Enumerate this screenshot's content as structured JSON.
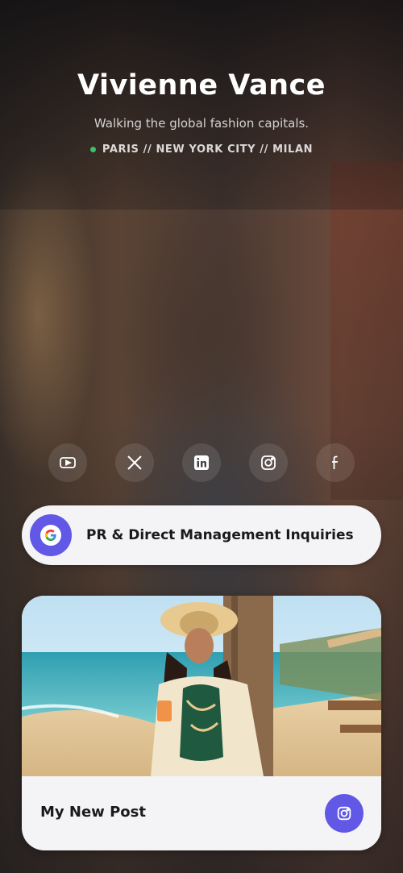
{
  "profile": {
    "name": "Vivienne Vance",
    "tagline": "Walking the global fashion capitals.",
    "location": "PARIS // NEW YORK CITY // MILAN"
  },
  "socials": [
    {
      "icon": "youtube-icon"
    },
    {
      "icon": "x-twitter-icon"
    },
    {
      "icon": "linkedin-icon"
    },
    {
      "icon": "instagram-icon"
    },
    {
      "icon": "facebook-icon"
    }
  ],
  "links": [
    {
      "label": "PR & Direct Management Inquiries",
      "icon": "google-icon"
    }
  ],
  "post": {
    "title": "My New Post",
    "icon": "instagram-icon"
  },
  "colors": {
    "accent": "#6158e6",
    "status_dot": "#3fbf6a",
    "card_bg": "#f4f4f6"
  }
}
